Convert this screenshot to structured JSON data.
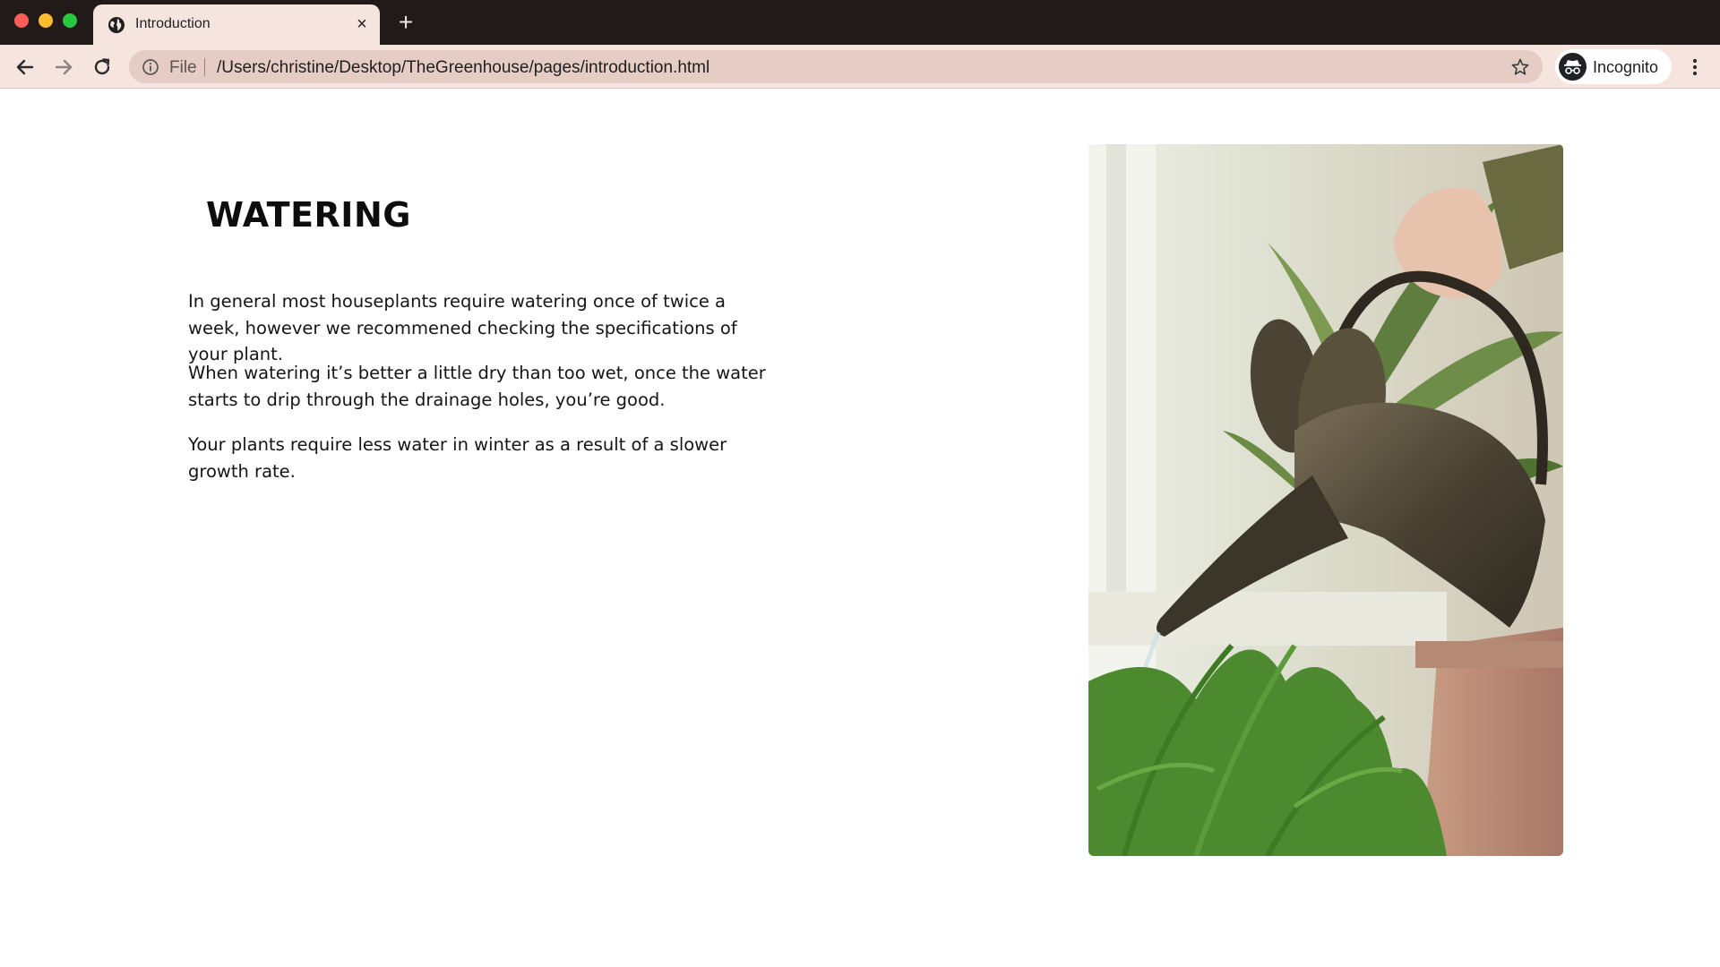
{
  "browser": {
    "tab": {
      "title": "Introduction"
    },
    "new_tab_label": "+",
    "close_label": "×",
    "address": {
      "scheme_label": "File",
      "url": "/Users/christine/Desktop/TheGreenhouse/pages/introduction.html"
    },
    "profile_label": "Incognito",
    "icons": [
      "globe-icon",
      "close-icon",
      "plus-icon",
      "back-arrow-icon",
      "forward-arrow-icon",
      "reload-icon",
      "info-icon",
      "star-icon",
      "incognito-icon",
      "kebab-menu-icon"
    ]
  },
  "page": {
    "heading": "WATERING",
    "paragraphs": [
      "In general most houseplants require watering once of twice a week, however we recommened checking the specifications of your plant.",
      "When watering it’s better a little dry than too wet, once the water starts to drip through the drainage holes, you’re good.",
      "Your plants require less water in winter as a result of a slower growth rate."
    ]
  },
  "colors": {
    "tab_strip": "#221a18",
    "toolbar": "#f6e4df",
    "omnibox": "#e5ccc5",
    "text": "#151515"
  }
}
